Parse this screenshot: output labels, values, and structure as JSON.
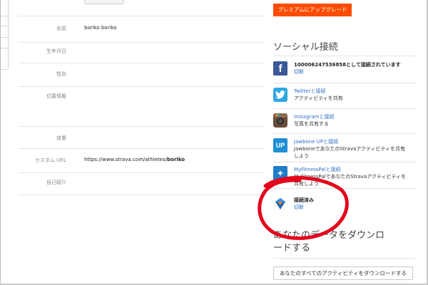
{
  "profile": {
    "rows": [
      {
        "label": "名前",
        "value": "boriko boriko"
      },
      {
        "label": "生年月日",
        "value": ""
      },
      {
        "label": "性別",
        "value": ""
      },
      {
        "label": "位置情報",
        "value": ""
      },
      {
        "label": "体重",
        "value": ""
      },
      {
        "label": "カスタム URL",
        "value_prefix": "https://www.strava.com/athletes/",
        "value_bold": "boriko"
      },
      {
        "label": "自己紹介",
        "value": ""
      }
    ]
  },
  "sidebar": {
    "upgrade_label": "プレミアムにアップグレード",
    "social_title": "ソーシャル接続",
    "services": [
      {
        "icon": "facebook-icon",
        "glyph": "f",
        "color": "#3b5998",
        "line1": "100006247536858として接続されています",
        "line2": "切断"
      },
      {
        "icon": "twitter-icon",
        "glyph": "🐦",
        "color": "#2fa9e0",
        "line1": "Twitterと接続",
        "line2": "アクティビティを共有"
      },
      {
        "icon": "instagram-icon",
        "glyph": "",
        "color": "#5c4334",
        "line1": "Instagramと接続",
        "line2": "写真を共有する"
      },
      {
        "icon": "jawbone-up-icon",
        "glyph": "UP",
        "color": "#1f8fd4",
        "line1": "Jawbone UPと接続",
        "line2": "JawboneであなたのStravaアクティビティを共有しよう"
      },
      {
        "icon": "myfitnesspal-icon",
        "glyph": "✦",
        "color": "#1f7cc8",
        "line1": "MyFitnessPalと接続",
        "line2": "MyFitnessPalであなたのStravaアクティビティを共有しよう"
      },
      {
        "icon": "garmin-icon",
        "glyph": "",
        "color": "#ffffff",
        "line1": "接続済み",
        "line2": "切断"
      }
    ],
    "download_title": "あなたのデータをダウンロードする",
    "download_button": "あなたのすべてのアクティビティをダウンロードする"
  },
  "colors": {
    "accent": "#fc4c02",
    "link": "#2f6fc0",
    "annotation": "#e4051b"
  }
}
